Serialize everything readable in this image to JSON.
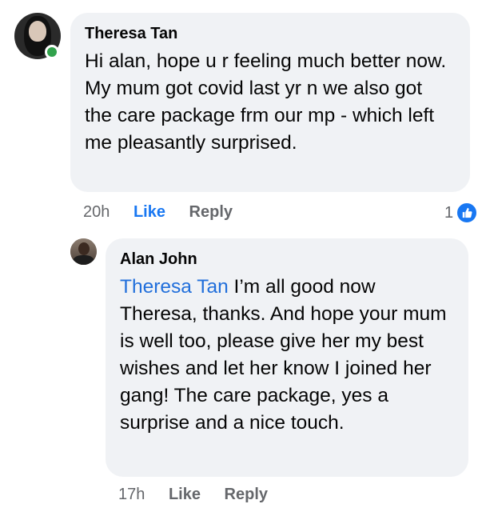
{
  "comments": [
    {
      "author": "Theresa Tan",
      "text": "Hi alan, hope u r feeling much better now. My mum got covid last yr n we also got the care package frm our mp - which left me pleasantly surprised.",
      "time": "20h",
      "like_label": "Like",
      "reply_label": "Reply",
      "reaction_count": "1",
      "online": true
    },
    {
      "author": "Alan John",
      "mention": "Theresa Tan",
      "text": " I’m all good now Theresa, thanks. And hope your mum is well too, please give her my best wishes and let her know I joined her gang! The care package, yes a surprise and a nice touch.",
      "time": "17h",
      "like_label": "Like",
      "reply_label": "Reply"
    }
  ],
  "colors": {
    "bubble": "#f0f2f5",
    "mention": "#216fdb",
    "like_active": "#1877f2",
    "meta": "#65676b",
    "online": "#31a24c"
  },
  "icons": [
    "thumbs-up-icon"
  ]
}
